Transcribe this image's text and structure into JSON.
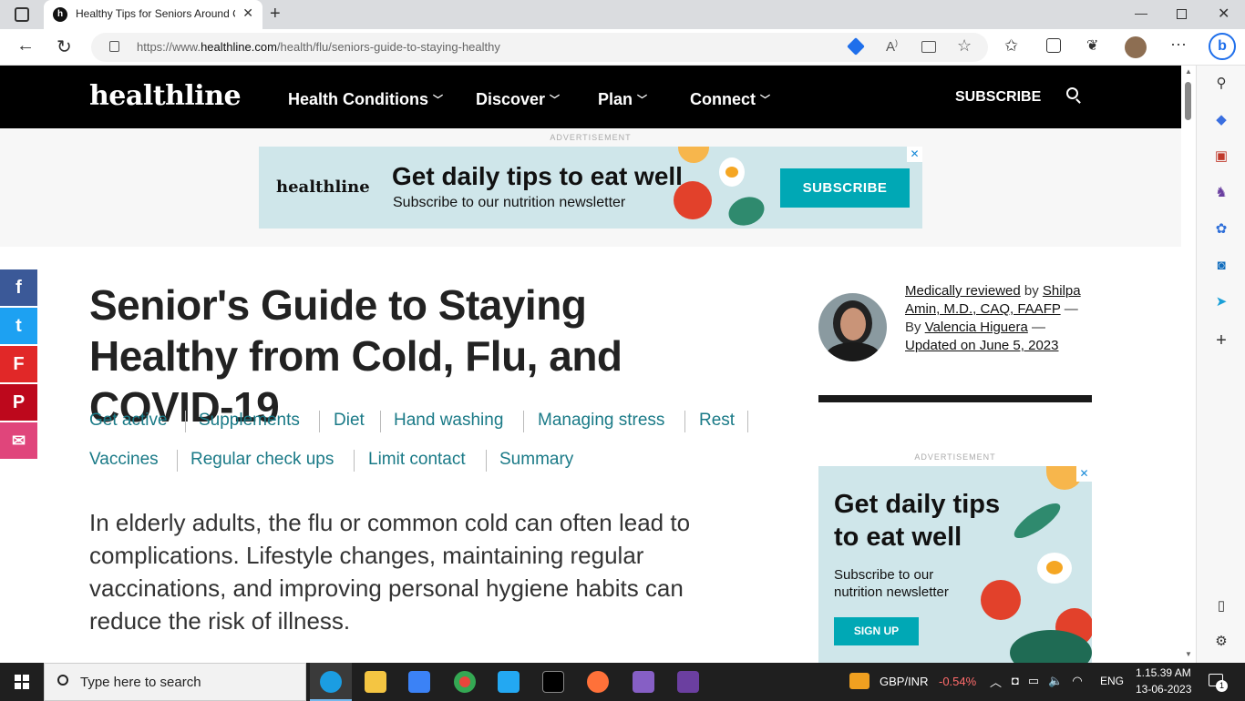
{
  "browser": {
    "tab_title": "Healthy Tips for Seniors Around C",
    "url_prefix": "https://www.",
    "url_domain": "healthline.com",
    "url_path": "/health/flu/seniors-guide-to-staying-healthy"
  },
  "site": {
    "logo": "healthline",
    "nav": [
      "Health Conditions",
      "Discover",
      "Plan",
      "Connect"
    ],
    "subscribe": "SUBSCRIBE"
  },
  "ad_top": {
    "label": "ADVERTISEMENT",
    "logo": "healthline",
    "headline": "Get daily tips to eat well",
    "sub": "Subscribe to our nutrition newsletter",
    "cta": "SUBSCRIBE"
  },
  "share": {
    "facebook": "f",
    "twitter": "t",
    "flipboard": "F",
    "pinterest": "P",
    "email": "✉"
  },
  "article": {
    "headline": "Senior's Guide to Staying Healthy from Cold, Flu, and COVID-19",
    "jump_links": [
      "Get active",
      "Supplements",
      "Diet",
      "Hand washing",
      "Managing stress",
      "Rest",
      "Vaccines",
      "Regular check ups",
      "Limit contact",
      "Summary"
    ],
    "intro": "In elderly adults, the flu or common cold can often lead to complications. Lifestyle changes, maintaining regular vaccinations, and improving personal hygiene habits can reduce the risk of illness."
  },
  "byline": {
    "reviewed": "Medically reviewed",
    "by1": " by ",
    "reviewer": "Shilpa Amin, M.D., CAQ, FAAFP",
    "by2": " — By ",
    "author": "Valencia Higuera",
    "dash": " — ",
    "updated": "Updated on June 5, 2023"
  },
  "ad_side": {
    "label": "ADVERTISEMENT",
    "headline": "Get daily tips to eat well",
    "sub": "Subscribe to our nutrition newsletter",
    "cta": "SIGN UP"
  },
  "taskbar": {
    "search_placeholder": "Type here to search",
    "ticker": "GBP/INR",
    "ticker_change": "-0.54%",
    "lang": "ENG",
    "time": "1.15.39 AM",
    "date": "13-06-2023",
    "notif_count": "1"
  },
  "colors": {
    "teal": "#1a7a87",
    "facebook": "#3b5998",
    "twitter": "#1da1f2",
    "flipboard": "#e12828",
    "pinterest": "#bd081c",
    "email": "#e0457b",
    "ad_bg": "#cfe6ea",
    "cta": "#00a8b5"
  }
}
